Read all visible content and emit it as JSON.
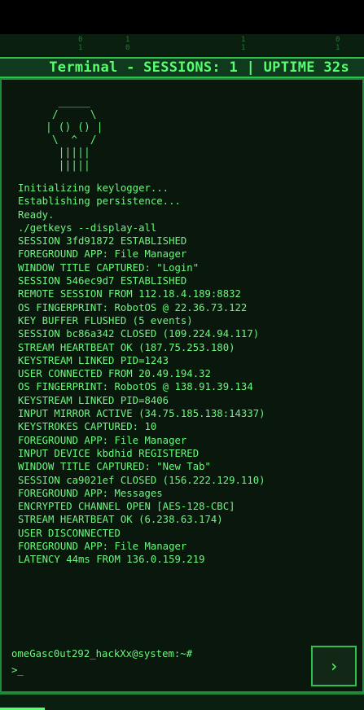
{
  "header": {
    "title": "Terminal - SESSIONS: 1 | UPTIME 32s"
  },
  "ascii_skull": "  _____\n /     \\\n| () () |\n \\  ^  /\n  |||||\n  |||||",
  "log_lines": [
    "Initializing keylogger...",
    "Establishing persistence...",
    "Ready.",
    "./getkeys --display-all",
    "SESSION 3fd91872 ESTABLISHED",
    "FOREGROUND APP: File Manager",
    "WINDOW TITLE CAPTURED: \"Login\"",
    "SESSION 546ec9d7 ESTABLISHED",
    "REMOTE SESSION FROM 112.18.4.189:8832",
    "OS FINGERPRINT: RobotOS @ 22.36.73.122",
    "KEY BUFFER FLUSHED (5 events)",
    "SESSION bc86a342 CLOSED (109.224.94.117)",
    "STREAM HEARTBEAT OK (187.75.253.180)",
    "KEYSTREAM LINKED PID=1243",
    "USER CONNECTED FROM 20.49.194.32",
    "OS FINGERPRINT: RobotOS @ 138.91.39.134",
    "KEYSTREAM LINKED PID=8406",
    "INPUT MIRROR ACTIVE (34.75.185.138:14337)",
    "KEYSTROKES CAPTURED: 10",
    "FOREGROUND APP: File Manager",
    "INPUT DEVICE kbdhid REGISTERED",
    "WINDOW TITLE CAPTURED: \"New Tab\"",
    "SESSION ca9021ef CLOSED (156.222.129.110)",
    "FOREGROUND APP: Messages",
    "ENCRYPTED CHANNEL OPEN [AES-128-CBC]",
    "STREAM HEARTBEAT OK (6.238.63.174)",
    "USER DISCONNECTED",
    "FOREGROUND APP: File Manager",
    "LATENCY 44ms FROM 136.0.159.219"
  ],
  "prompt": {
    "text": "omeGasc0ut292_hackXx@system:~#",
    "input_value": ">_"
  },
  "send_button": {
    "icon": "chevron-right-icon",
    "glyph": "›"
  },
  "colors": {
    "accent": "#55ff6e",
    "background": "#081a0e",
    "border": "#2ec24c"
  }
}
